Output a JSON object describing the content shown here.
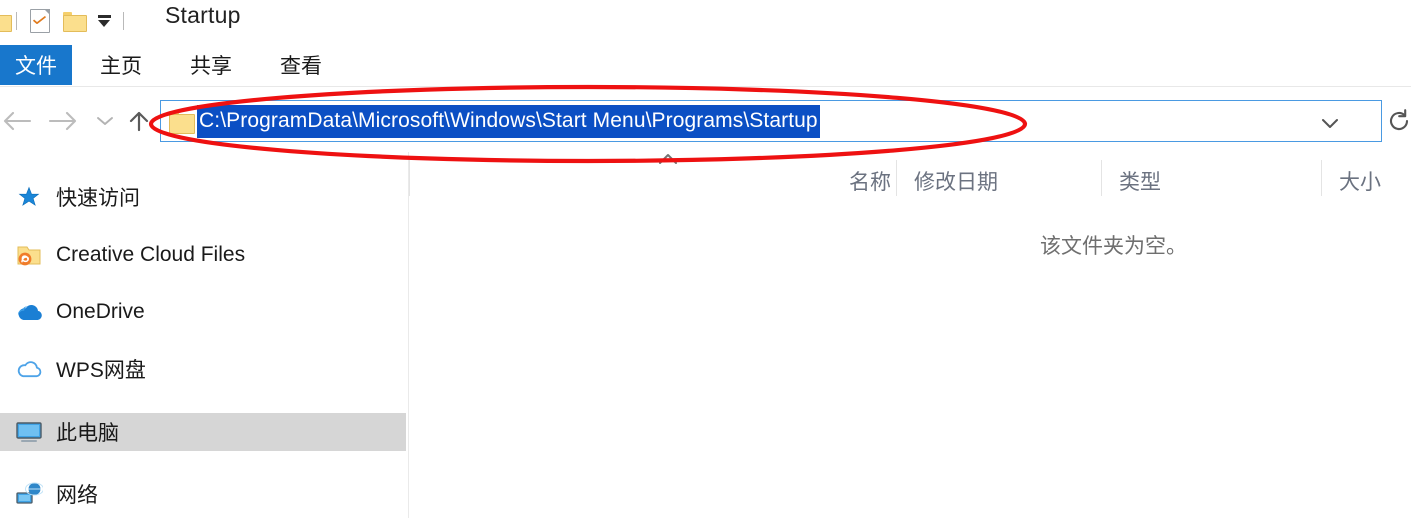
{
  "window": {
    "title": "Startup",
    "quick_access": [
      {
        "name": "folder-partial-icon",
        "label": ""
      },
      {
        "name": "properties-document-icon",
        "label": ""
      },
      {
        "name": "new-folder-icon",
        "label": ""
      },
      {
        "name": "customize-quick-access-caret-icon",
        "label": ""
      }
    ]
  },
  "ribbon": {
    "tabs": [
      {
        "label": "文件",
        "selected": true
      },
      {
        "label": "主页",
        "selected": false
      },
      {
        "label": "共享",
        "selected": false
      },
      {
        "label": "查看",
        "selected": false
      }
    ]
  },
  "navigation": {
    "back_icon": "back-arrow-icon",
    "forward_icon": "forward-arrow-icon",
    "recent_icon": "recent-locations-chevron-icon",
    "up_icon": "up-arrow-icon",
    "back_enabled": false,
    "forward_enabled": false,
    "up_enabled": true
  },
  "address_bar": {
    "value": "C:\\ProgramData\\Microsoft\\Windows\\Start Menu\\Programs\\Startup",
    "placeholder": "",
    "text_selected": true,
    "selection_color": "#0b4fc4",
    "border_color": "#4a9ae2",
    "folder_icon": "folder-icon",
    "dropdown_icon": "chevron-down-icon",
    "refresh_icon": "refresh-icon"
  },
  "sidebar": {
    "items": [
      {
        "label": "快速访问",
        "icon": "star-icon",
        "selected": false
      },
      {
        "label": "Creative Cloud Files",
        "icon": "creative-cloud-folder-icon",
        "selected": false
      },
      {
        "label": "OneDrive",
        "icon": "onedrive-cloud-icon",
        "selected": false
      },
      {
        "label": "WPS网盘",
        "icon": "wps-cloud-icon",
        "selected": false
      },
      {
        "label": "此电脑",
        "icon": "this-pc-monitor-icon",
        "selected": true
      },
      {
        "label": "网络",
        "icon": "network-icon",
        "selected": false
      }
    ]
  },
  "file_list": {
    "columns": [
      {
        "label": "名称",
        "sorted": "asc"
      },
      {
        "label": "修改日期",
        "sorted": ""
      },
      {
        "label": "类型",
        "sorted": ""
      },
      {
        "label": "大小",
        "sorted": ""
      }
    ],
    "rows": [],
    "empty_message": "该文件夹为空。"
  },
  "annotation": {
    "shape": "ellipse",
    "color": "#ee1111",
    "target": "address-bar"
  }
}
